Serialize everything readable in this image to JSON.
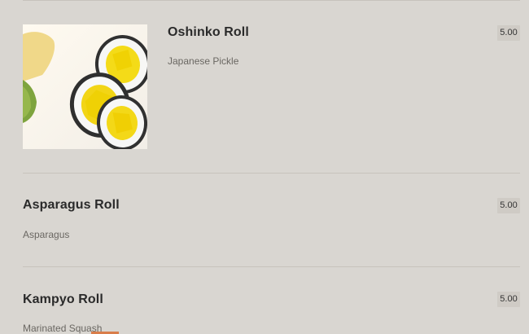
{
  "menu": {
    "items": [
      {
        "title": "Oshinko Roll",
        "description": "Japanese Pickle",
        "price": "5.00",
        "image_icon": "sushi-roll-image"
      },
      {
        "title": "Asparagus Roll",
        "description": "Asparagus",
        "price": "5.00"
      },
      {
        "title": "Kampyo Roll",
        "description": "Marinated Squash",
        "price": "5.00"
      }
    ]
  },
  "colors": {
    "background": "#d9d6d1",
    "divider": "#c7c3bc",
    "price_badge": "#cfcbc5",
    "title": "#2a2a2a",
    "description": "#6a6762"
  }
}
